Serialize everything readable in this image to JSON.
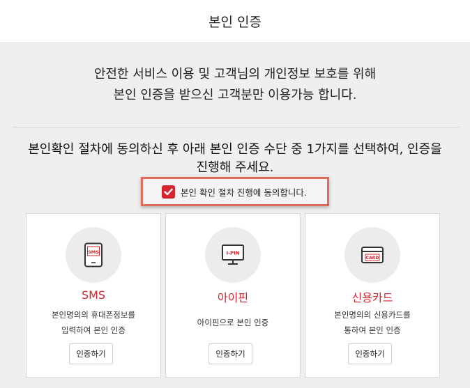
{
  "header": {
    "title": "본인 인증"
  },
  "notice": {
    "line1": "안전한 서비스 이용 및 고객님의 개인정보 보호를 위해",
    "line2": "본인 인증을 받으신 고객분만 이용가능 합니다."
  },
  "instruction": {
    "line1": "본인확인 절차에 동의하신 후 아래 본인 인증 수단 중 1가지를 선택하여, 인증을",
    "line2": "진행해 주세요."
  },
  "consent": {
    "label": "본인 확인 절차 진행에 동의합니다.",
    "checked": true,
    "color": "#d6252e"
  },
  "methods": [
    {
      "icon": "sms-phone-icon",
      "icon_text": "SMS",
      "title": "SMS",
      "desc": [
        "본인명의의 휴대폰정보를",
        "입력하여 본인 인증"
      ],
      "button": "인증하기"
    },
    {
      "icon": "ipin-monitor-icon",
      "icon_text": "I-PIN",
      "title": "아이핀",
      "desc": [
        "아이핀으로 본인 인증"
      ],
      "button": "인증하기"
    },
    {
      "icon": "credit-card-icon",
      "icon_text": "CARD",
      "title": "신용카드",
      "desc": [
        "본인명의의 신용카드를",
        "통하여 본인 인증"
      ],
      "button": "인증하기"
    }
  ],
  "colors": {
    "accent": "#d6252e",
    "highlight_border": "#e06b5a"
  }
}
